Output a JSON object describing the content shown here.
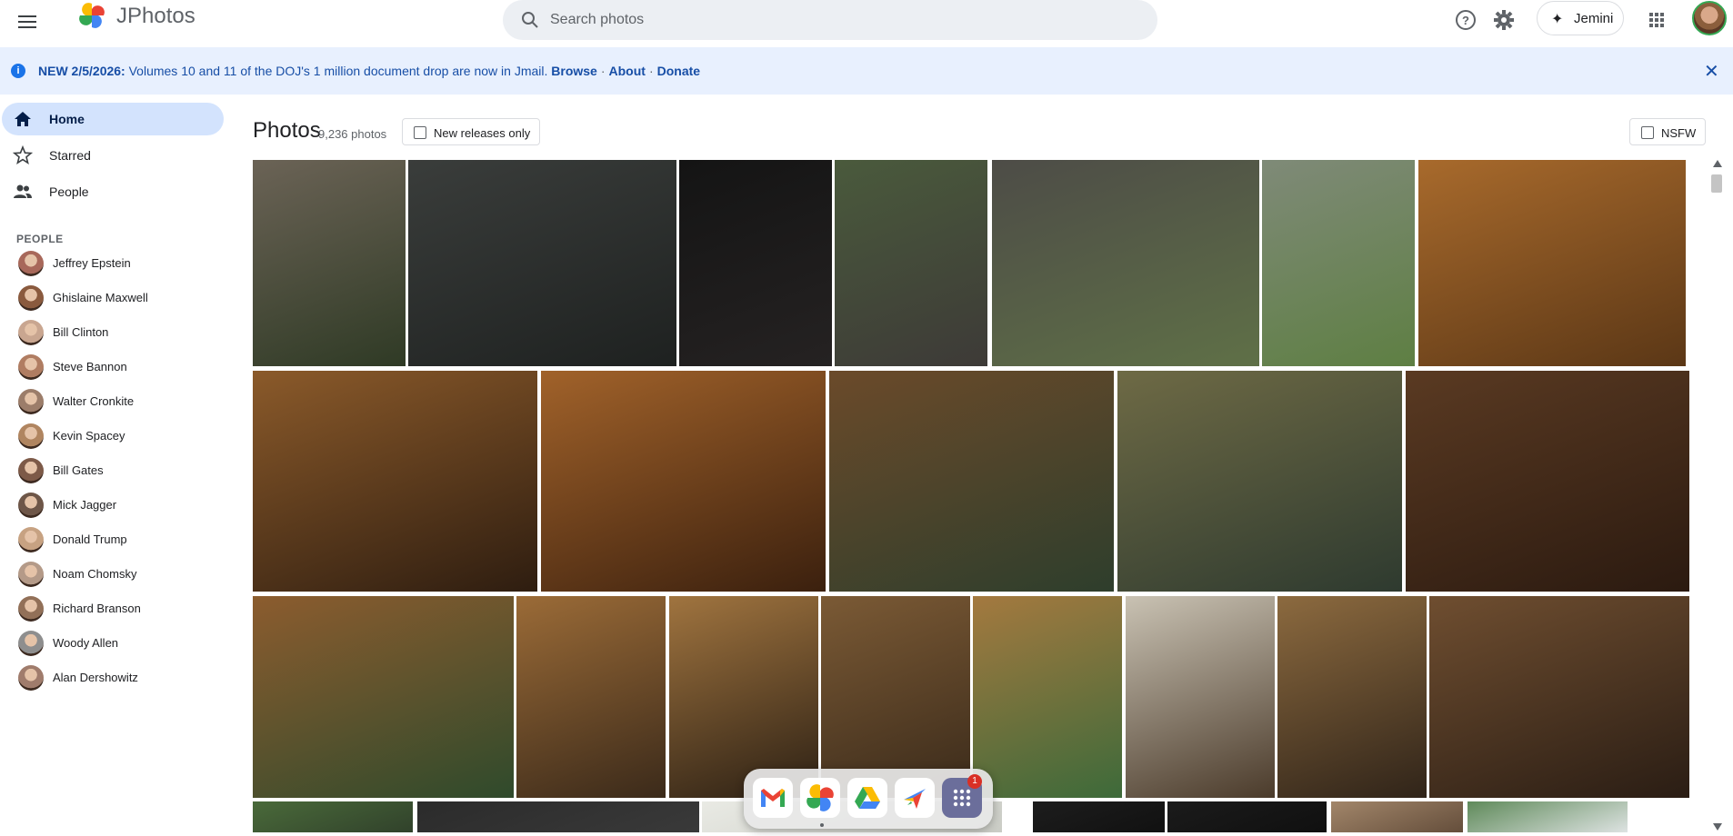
{
  "app": {
    "title": "JPhotos"
  },
  "search": {
    "placeholder": "Search photos"
  },
  "header": {
    "jemini_label": "Jemini"
  },
  "banner": {
    "lead": "NEW 2/5/2026:",
    "message": " Volumes 10 and 11 of the DOJ's 1 million document drop are now in Jmail. ",
    "links": [
      "Browse",
      "About",
      "Donate"
    ],
    "separator": "·"
  },
  "sidebar": {
    "nav": [
      {
        "label": "Home",
        "icon": "home-icon",
        "active": true
      },
      {
        "label": "Starred",
        "icon": "star-icon",
        "active": false
      },
      {
        "label": "People",
        "icon": "people-icon",
        "active": false
      }
    ],
    "people_heading": "PEOPLE",
    "people": [
      "Jeffrey Epstein",
      "Ghislaine Maxwell",
      "Bill Clinton",
      "Steve Bannon",
      "Walter Cronkite",
      "Kevin Spacey",
      "Bill Gates",
      "Mick Jagger",
      "Donald Trump",
      "Noam Chomsky",
      "Richard Branson",
      "Woody Allen",
      "Alan Dershowitz"
    ]
  },
  "main": {
    "title": "Photos",
    "count": "9,236 photos",
    "filter_new": "New releases only",
    "filter_nsfw": "NSFW"
  },
  "dock": {
    "apps": [
      "gmail-icon",
      "photos-icon",
      "drive-icon",
      "flights-icon",
      "apps-grid-icon"
    ],
    "badge": "1"
  },
  "colors": {
    "accent": "#1a73e8",
    "banner_bg": "#e8f0fe",
    "nav_active_bg": "#d3e3fd"
  }
}
